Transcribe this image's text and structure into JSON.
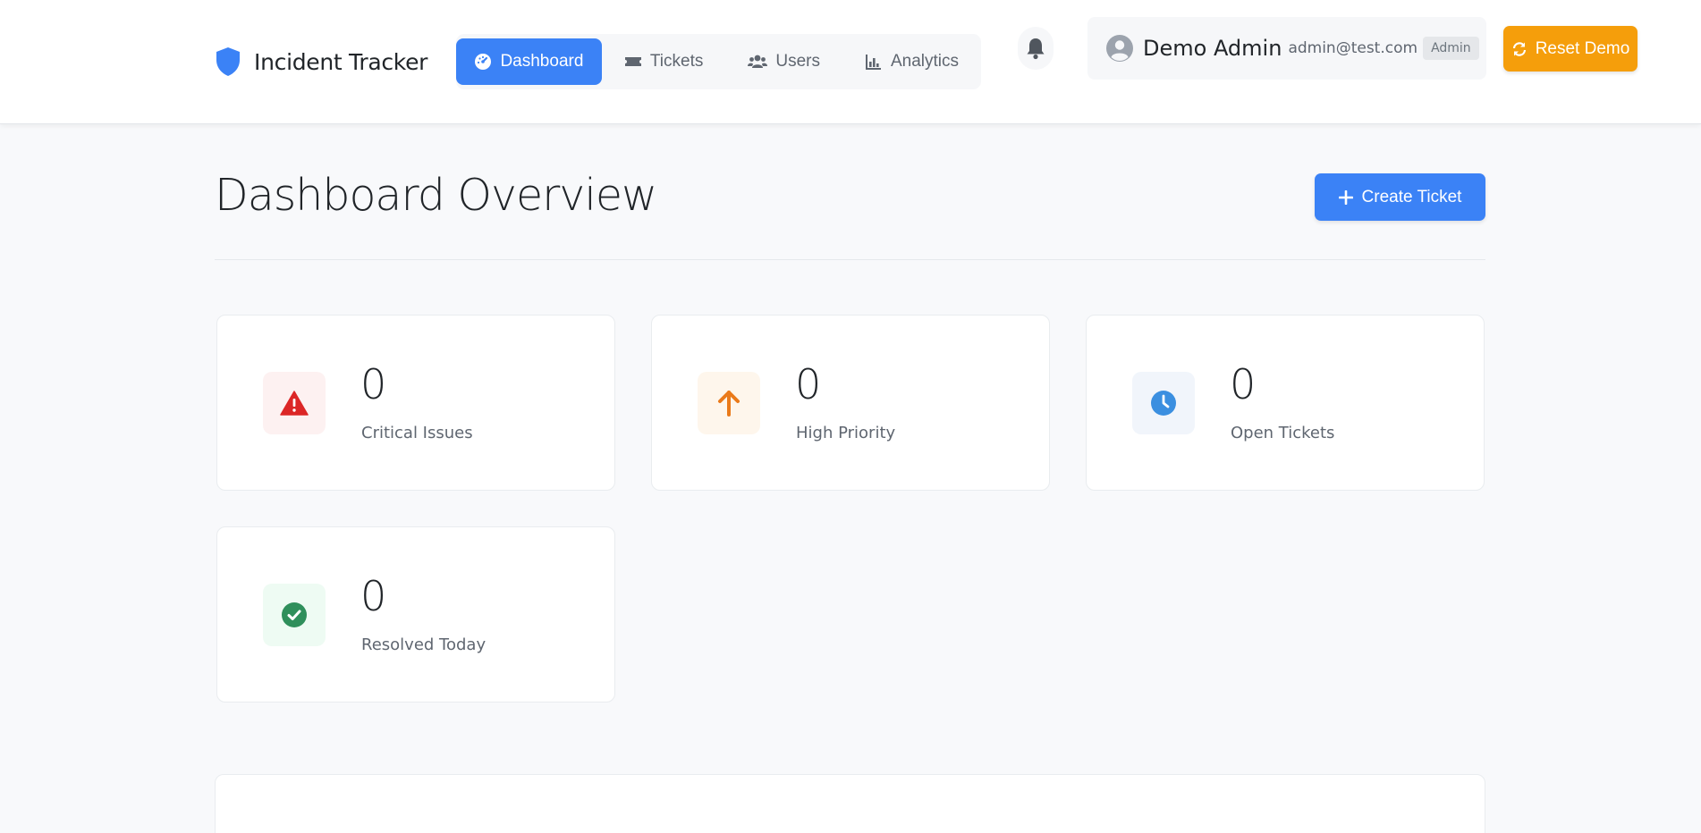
{
  "brand": {
    "name": "Incident Tracker",
    "icon": "shield-icon",
    "accent": "#3b82f6"
  },
  "nav": {
    "items": [
      {
        "label": "Dashboard",
        "icon": "dashboard-gauge-icon",
        "active": true
      },
      {
        "label": "Tickets",
        "icon": "ticket-icon",
        "active": false
      },
      {
        "label": "Users",
        "icon": "users-icon",
        "active": false
      },
      {
        "label": "Analytics",
        "icon": "chart-icon",
        "active": false
      }
    ]
  },
  "notifications": {
    "icon": "bell-icon"
  },
  "user": {
    "name": "Demo Admin",
    "email": "admin@test.com",
    "role": "Admin",
    "icon": "user-circle-icon"
  },
  "reset_button": {
    "label": "Reset Demo",
    "icon": "refresh-icon",
    "color": "#f59e0b"
  },
  "page": {
    "title": "Dashboard Overview"
  },
  "create_button": {
    "label": "Create Ticket",
    "icon": "plus-icon",
    "color": "#3b82f6"
  },
  "stats": [
    {
      "value": "0",
      "label": "Critical Issues",
      "icon": "warning-triangle-icon",
      "color": "#dc2626"
    },
    {
      "value": "0",
      "label": "High Priority",
      "icon": "arrow-up-icon",
      "color": "#ea7a1a"
    },
    {
      "value": "0",
      "label": "Open Tickets",
      "icon": "clock-icon",
      "color": "#3b8fe0"
    },
    {
      "value": "0",
      "label": "Resolved Today",
      "icon": "check-circle-icon",
      "color": "#2f8f5b"
    }
  ]
}
